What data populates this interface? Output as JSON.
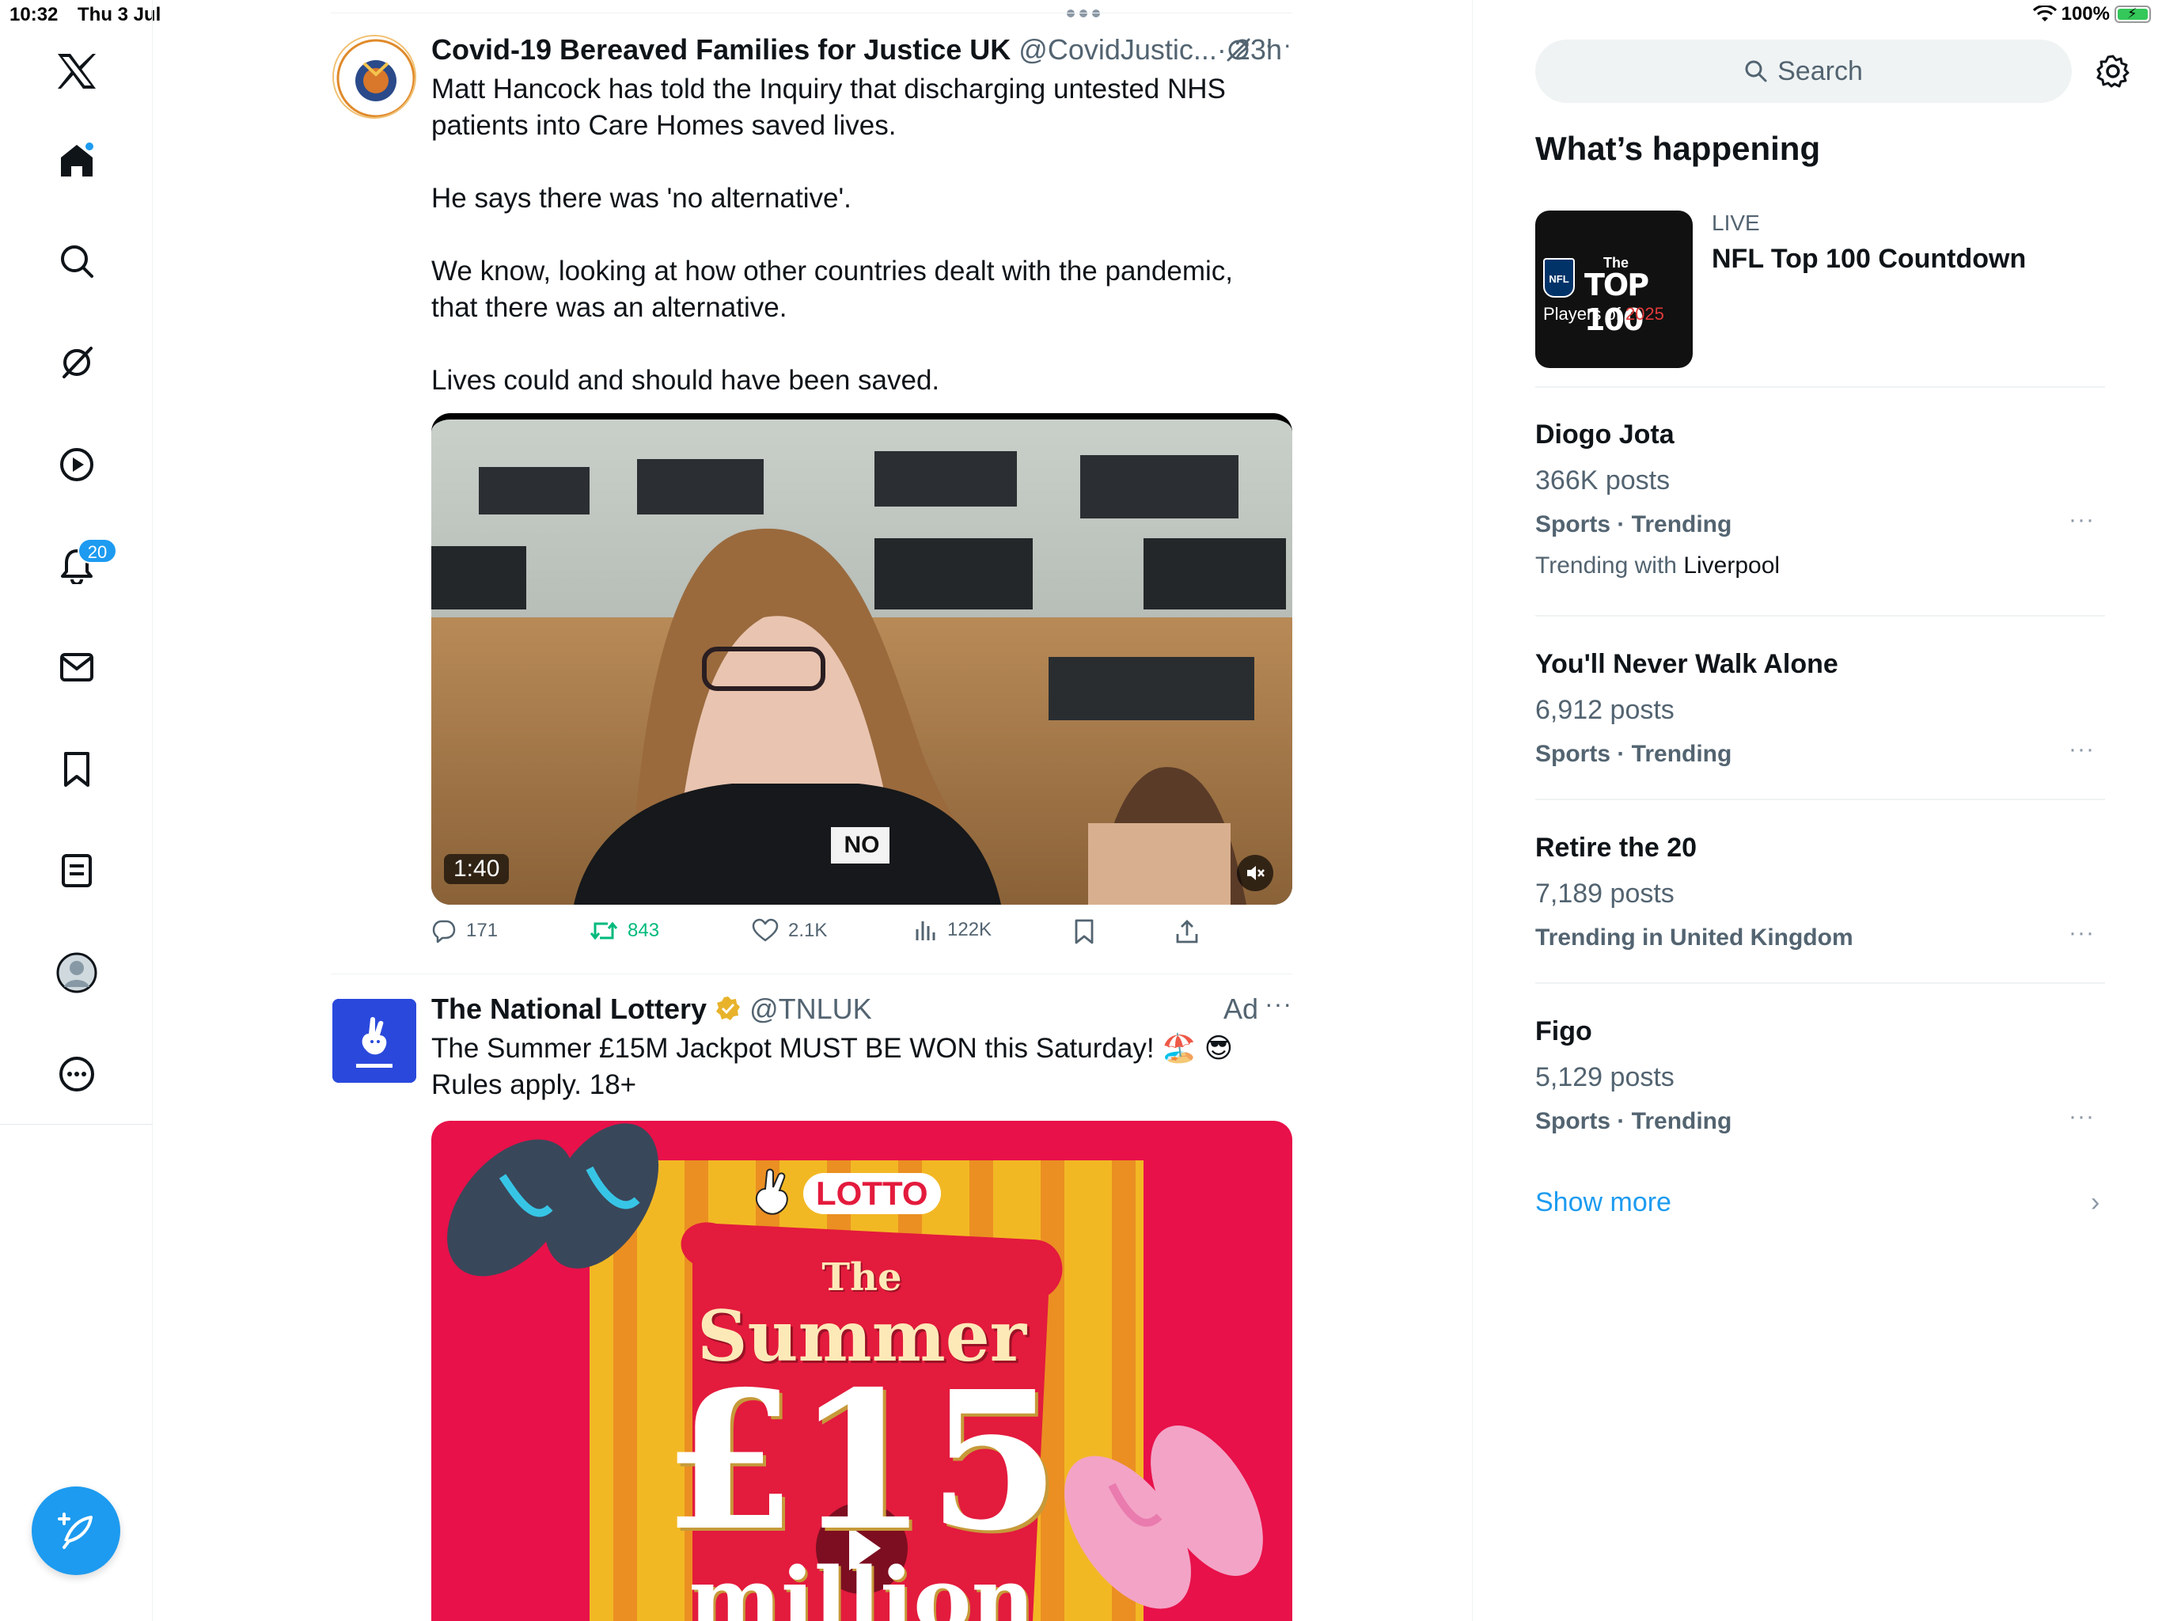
{
  "status_bar": {
    "time": "10:32",
    "date": "Thu 3 Jul",
    "battery": "100%",
    "battery_level": 1.0
  },
  "nav": {
    "notifications_count": "20",
    "icons": [
      "x-logo-icon",
      "home-icon",
      "search-icon",
      "grok-icon",
      "video-icon",
      "notifications-icon",
      "messages-icon",
      "bookmarks-icon",
      "lists-icon",
      "profile-icon",
      "more-icon",
      "compose-icon"
    ]
  },
  "feed": {
    "tweet1": {
      "name": "Covid-19 Bereaved Families for Justice UK",
      "handle": "@CovidJustic...",
      "time": "· 23h",
      "paragraphs": [
        "Matt Hancock has told the Inquiry that discharging untested NHS patients into Care Homes saved lives.",
        "He says there was 'no alternative'.",
        "We know, looking at how other countries dealt with the pandemic, that there was an alternative.",
        "Lives could and should have been saved."
      ],
      "video_duration": "1:40",
      "video_overlay": "NO",
      "replies": "171",
      "reposts": "843",
      "likes": "2.1K",
      "views": "122K"
    },
    "tweet2": {
      "name": "The National Lottery",
      "handle": "@TNLUK",
      "ad_label": "Ad",
      "text_line1": "The Summer £15M Jackpot MUST BE WON this Saturday! 🏖️ 😎",
      "text_line2": "Rules apply. 18+",
      "creative": {
        "brand": "LOTTO",
        "line1": "The",
        "line2": "Summer",
        "line3": "£15",
        "line4": "million"
      }
    }
  },
  "sidebar": {
    "search_placeholder": "Search",
    "section_title": "What’s happening",
    "live": {
      "label": "LIVE",
      "title": "NFL Top 100 Countdown",
      "thumb_line1": "The",
      "thumb_line2": "TOP 100",
      "thumb_line3": "Players of",
      "thumb_year": "2025",
      "thumb_logo": "NFL"
    },
    "trends": [
      {
        "name": "Diogo Jota",
        "count": "366K posts",
        "category": "Sports · Trending",
        "with_prefix": "Trending with",
        "with_name": "Liverpool"
      },
      {
        "name": "You'll Never Walk Alone",
        "count": "6,912 posts",
        "category": "Sports · Trending"
      },
      {
        "name": "Retire the 20",
        "count": "7,189 posts",
        "category": "Trending in United Kingdom"
      },
      {
        "name": "Figo",
        "count": "5,129 posts",
        "category": "Sports · Trending"
      }
    ],
    "show_more": "Show more"
  },
  "colors": {
    "accent": "#1d9bf0",
    "repost_green": "#00ba7c",
    "text_secondary": "#536471"
  }
}
